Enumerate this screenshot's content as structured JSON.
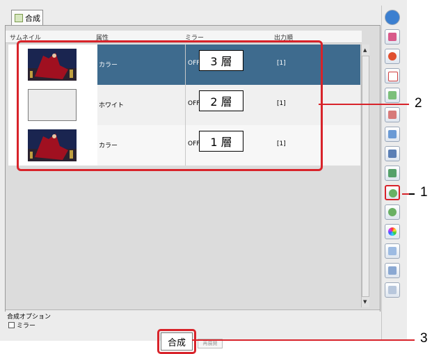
{
  "tab": {
    "label": "合成"
  },
  "table": {
    "headers": [
      "サムネイル",
      "属性",
      "ミラー",
      "出力順"
    ],
    "rows": [
      {
        "attribute": "カラー",
        "mirror": "OFF",
        "layer": "3 層",
        "order": "[1]",
        "selected": true,
        "thumbnail": "color-photo"
      },
      {
        "attribute": "ホワイト",
        "mirror": "OFF",
        "layer": "2 層",
        "order": "[1]",
        "selected": false,
        "thumbnail": "white-blank"
      },
      {
        "attribute": "カラー",
        "mirror": "OFF",
        "layer": "1 層",
        "order": "[1]",
        "selected": false,
        "thumbnail": "color-photo"
      }
    ]
  },
  "options": {
    "title": "合成オプション",
    "mirror_label": "ミラー",
    "mirror_checked": false
  },
  "buttons": {
    "merge": "合成",
    "free": "再展開"
  },
  "callouts": [
    "2",
    "1",
    "3"
  ],
  "colors": {
    "selected_row": "#3e6b8e",
    "callout_red": "#d8232a"
  }
}
